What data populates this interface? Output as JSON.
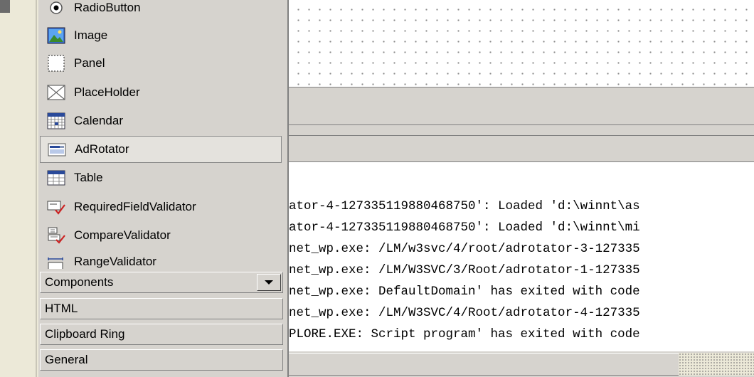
{
  "toolbox": {
    "items": [
      {
        "label": "RadioButton",
        "icon": "radiobutton-icon"
      },
      {
        "label": "Image",
        "icon": "image-icon"
      },
      {
        "label": "Panel",
        "icon": "panel-icon"
      },
      {
        "label": "PlaceHolder",
        "icon": "placeholder-icon"
      },
      {
        "label": "Calendar",
        "icon": "calendar-icon"
      },
      {
        "label": "AdRotator",
        "icon": "adrotator-icon",
        "selected": true
      },
      {
        "label": "Table",
        "icon": "table-icon"
      },
      {
        "label": "RequiredFieldValidator",
        "icon": "requiredfieldvalidator-icon"
      },
      {
        "label": "CompareValidator",
        "icon": "comparevalidator-icon"
      },
      {
        "label": "RangeValidator",
        "icon": "rangevalidator-icon"
      }
    ],
    "tabs": [
      {
        "label": "Components",
        "has_dropdown": true
      },
      {
        "label": "HTML"
      },
      {
        "label": "Clipboard Ring"
      },
      {
        "label": "General"
      }
    ]
  },
  "output": {
    "lines": [
      "ator-4-127335119880468750': Loaded 'd:\\winnt\\as",
      "ator-4-127335119880468750': Loaded 'd:\\winnt\\mi",
      "net_wp.exe: /LM/w3svc/4/root/adrotator-3-127335",
      "net_wp.exe: /LM/W3SVC/3/Root/adrotator-1-127335",
      "net_wp.exe: DefaultDomain' has exited with code",
      "net_wp.exe: /LM/W3SVC/4/Root/adrotator-4-127335",
      "PLORE.EXE: Script program' has exited with code"
    ]
  }
}
